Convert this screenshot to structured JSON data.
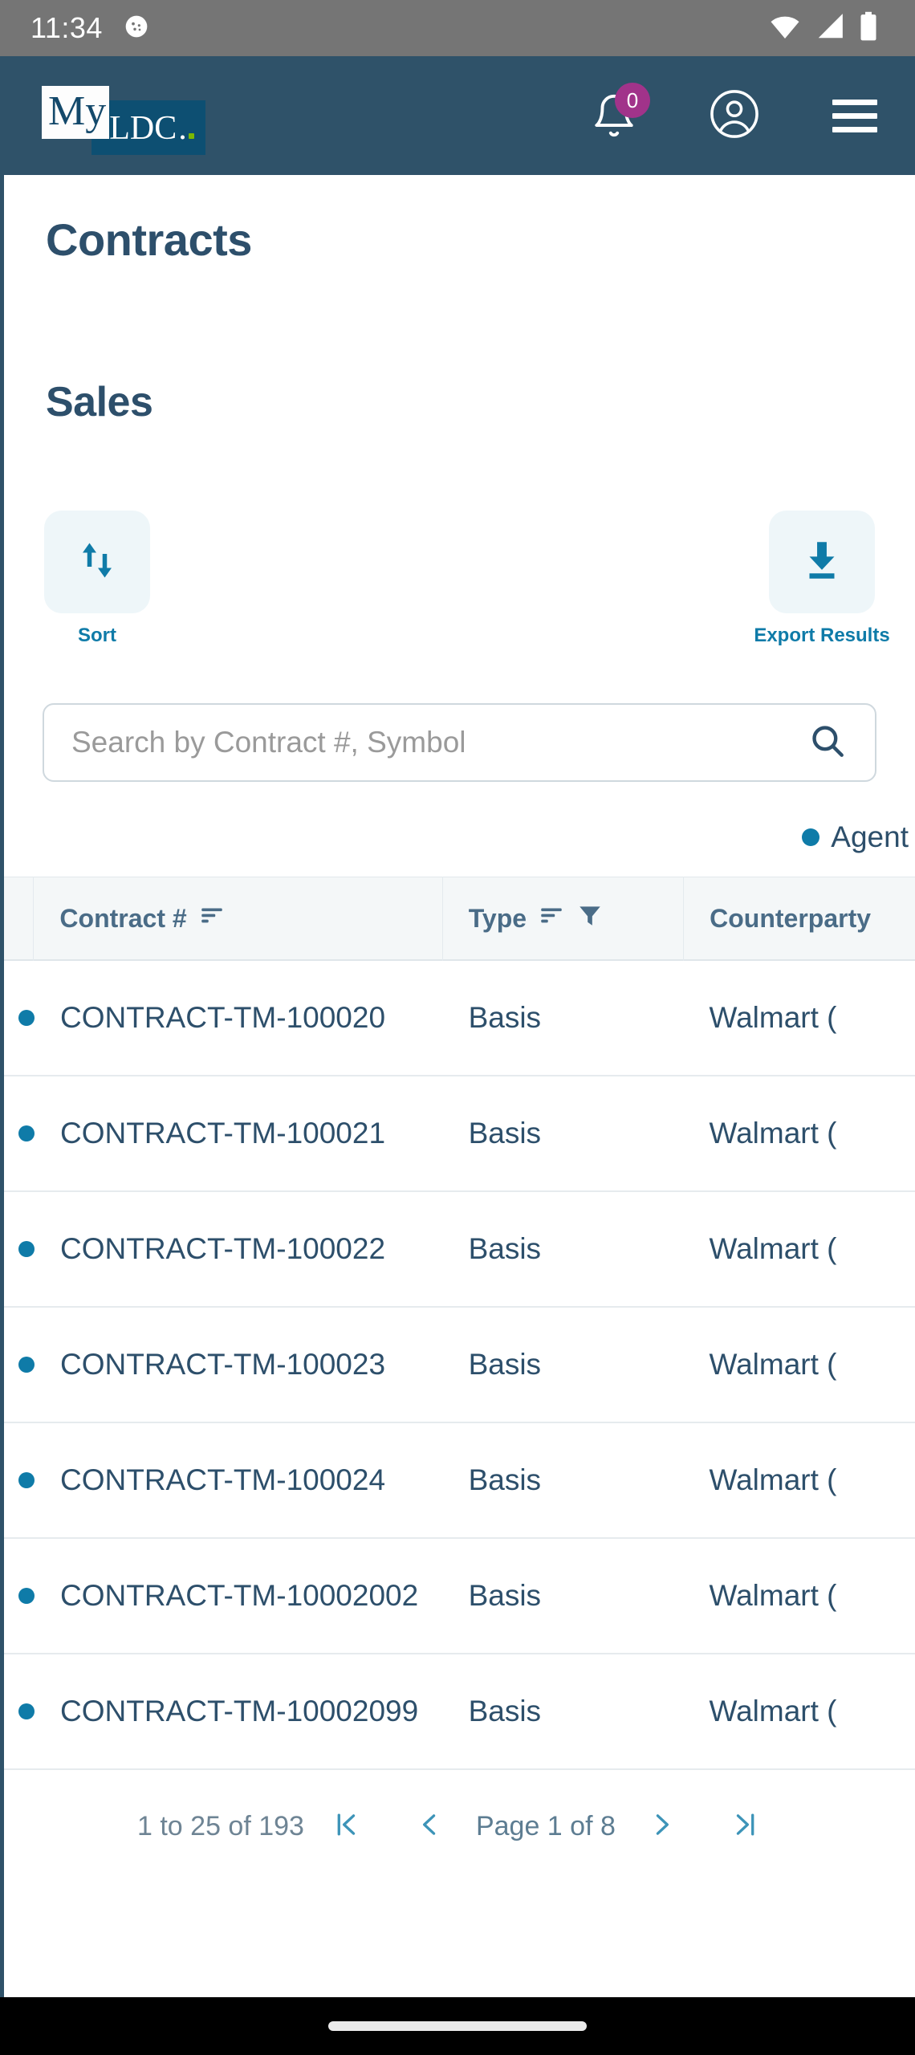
{
  "status_bar": {
    "time": "11:34",
    "icons": [
      "cookie-icon",
      "wifi-icon",
      "cellular-signal-icon",
      "battery-icon"
    ]
  },
  "header": {
    "logo_primary": "My",
    "logo_secondary": "LDC",
    "logo_period": ".",
    "notifications_badge": "0",
    "icons": [
      "notification-bell-icon",
      "account-circle-icon",
      "hamburger-menu-icon"
    ]
  },
  "page": {
    "title": "Contracts",
    "section": "Sales"
  },
  "actions": [
    {
      "label": "Sort",
      "icon": "sort-arrows-icon"
    },
    {
      "label": "Export Results",
      "icon": "download-icon"
    }
  ],
  "search": {
    "placeholder": "Search by Contract #, Symbol",
    "value": "",
    "icon": "search-icon"
  },
  "legend": [
    {
      "label": "Agent",
      "color": "#0f7ba8"
    }
  ],
  "table": {
    "columns": [
      {
        "label": "Contract #",
        "sortable": true,
        "filterable": false
      },
      {
        "label": "Type",
        "sortable": true,
        "filterable": true
      },
      {
        "label": "Counterparty",
        "sortable": false,
        "filterable": false
      }
    ],
    "rows": [
      {
        "contract": "CONTRACT-TM-100020",
        "type": "Basis",
        "counterparty": "Walmart ("
      },
      {
        "contract": "CONTRACT-TM-100021",
        "type": "Basis",
        "counterparty": "Walmart ("
      },
      {
        "contract": "CONTRACT-TM-100022",
        "type": "Basis",
        "counterparty": "Walmart ("
      },
      {
        "contract": "CONTRACT-TM-100023",
        "type": "Basis",
        "counterparty": "Walmart ("
      },
      {
        "contract": "CONTRACT-TM-100024",
        "type": "Basis",
        "counterparty": "Walmart ("
      },
      {
        "contract": "CONTRACT-TM-10002002",
        "type": "Basis",
        "counterparty": "Walmart ("
      },
      {
        "contract": "CONTRACT-TM-10002099",
        "type": "Basis",
        "counterparty": "Walmart ("
      }
    ]
  },
  "pagination": {
    "range_text": "1 to 25 of 193",
    "page_text": "Page 1 of 8",
    "first_icon": "first-page-icon",
    "prev_icon": "previous-page-icon",
    "next_icon": "next-page-icon",
    "last_icon": "last-page-icon"
  },
  "colors": {
    "header_bg": "#2f5269",
    "accent_blue": "#0f7ba8",
    "text_navy": "#2d4f6b",
    "badge_purple": "#a1338a",
    "tile_bg": "#eef6f9"
  }
}
